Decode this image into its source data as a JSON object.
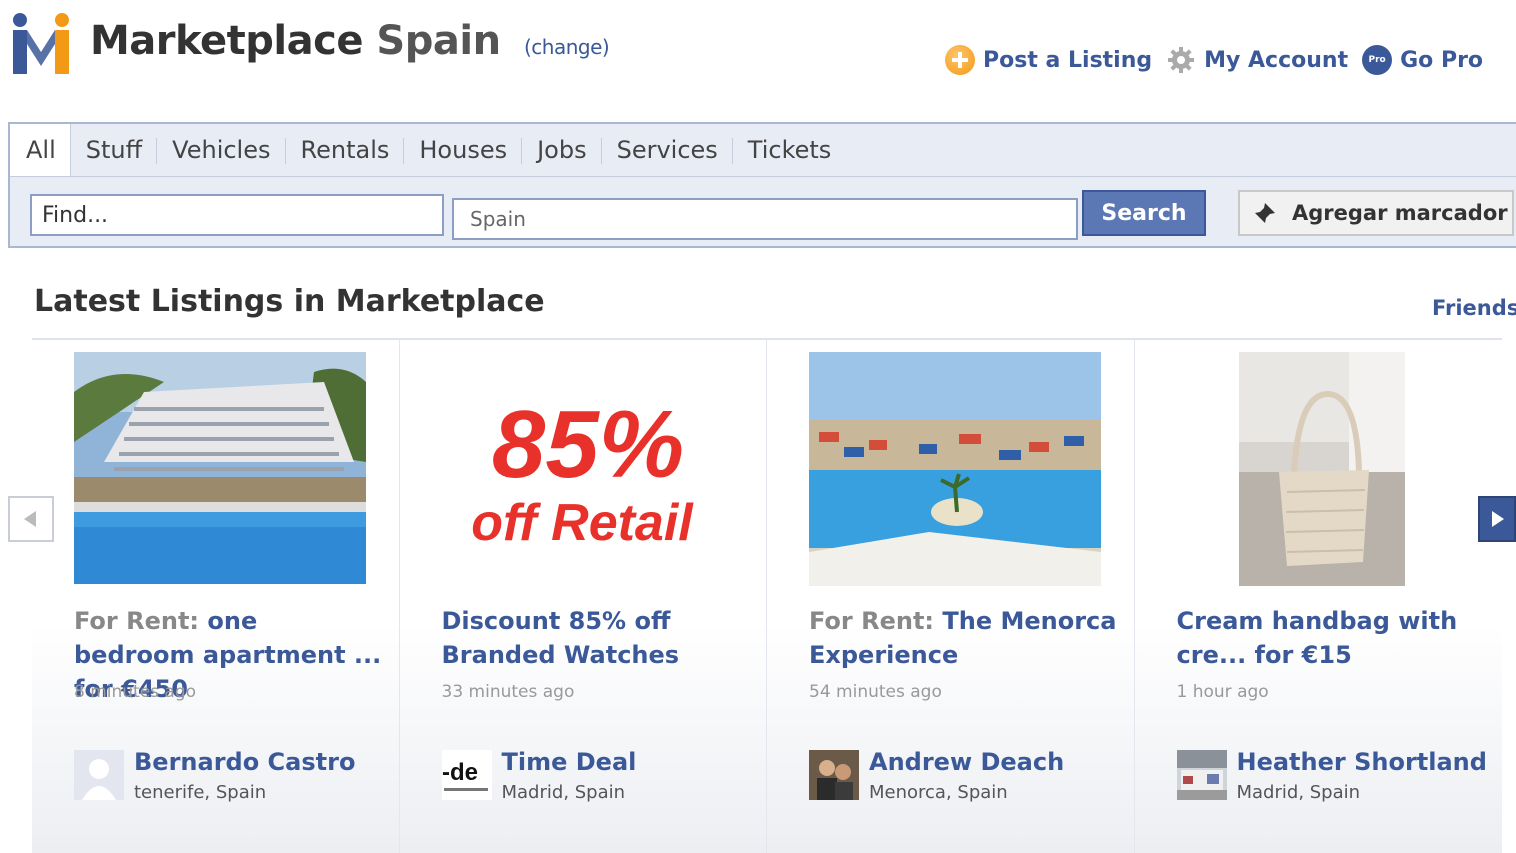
{
  "header": {
    "app_name": "Marketplace",
    "country": "Spain",
    "change_label": "(change)",
    "links": [
      {
        "label": "Post a Listing",
        "icon": "plus-icon"
      },
      {
        "label": "My Account",
        "icon": "gear-icon"
      },
      {
        "label": "Go Pro",
        "icon": "pro-icon",
        "icon_text": "Pro"
      }
    ]
  },
  "tabs": [
    "All",
    "Stuff",
    "Vehicles",
    "Rentals",
    "Houses",
    "Jobs",
    "Services",
    "Tickets"
  ],
  "active_tab": "All",
  "search": {
    "find_value": "Find...",
    "location_value": "Spain",
    "search_label": "Search",
    "bookmark_label": "Agregar marcador"
  },
  "section": {
    "title": "Latest Listings in Marketplace",
    "friends_label": "Friends"
  },
  "listings": [
    {
      "prefix": "For Rent:",
      "title": "one bedroom apartment ... for €450",
      "time": "8 minutes ago",
      "seller": "Bernardo Castro",
      "location": "tenerife, Spain"
    },
    {
      "prefix": "",
      "title": "Discount 85% off Branded Watches",
      "time": "33 minutes ago",
      "seller": "Time Deal",
      "location": "Madrid, Spain",
      "image_text": "85%",
      "image_subtext": "off Retail",
      "avatar_text": "-de"
    },
    {
      "prefix": "For Rent:",
      "title": "The Menorca Experience",
      "time": "54 minutes ago",
      "seller": "Andrew Deach",
      "location": "Menorca, Spain"
    },
    {
      "prefix": "",
      "title": "Cream handbag with cre... for €15",
      "time": "1 hour ago",
      "seller": "Heather Shortland",
      "location": "Madrid, Spain"
    }
  ],
  "colors": {
    "brand_blue": "#3b5998",
    "accent_orange": "#f29a16",
    "sale_red": "#e8312a"
  }
}
